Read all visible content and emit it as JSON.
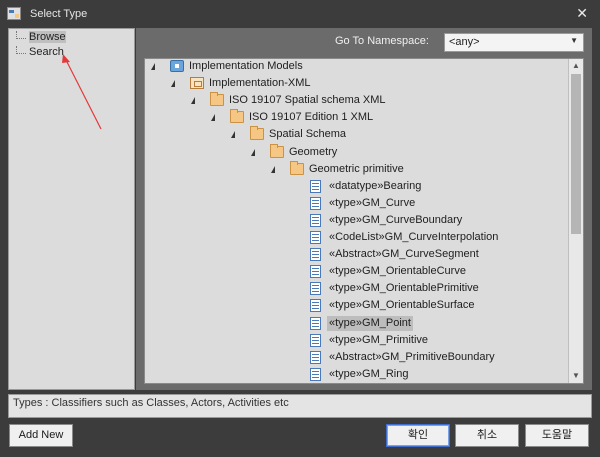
{
  "window": {
    "title": "Select Type",
    "close_glyph": "✕"
  },
  "left_panel": {
    "items": [
      {
        "label": "Browse"
      },
      {
        "label": "Search"
      }
    ]
  },
  "namespace": {
    "label": "Go To Namespace:",
    "selected": "<any>"
  },
  "tree": {
    "rows": [
      {
        "label": "Implementation Models",
        "icon": "model-icon",
        "level": 0,
        "expanded": true
      },
      {
        "label": "Implementation-XML",
        "icon": "package-icon",
        "level": 1,
        "expanded": true
      },
      {
        "label": "ISO 19107 Spatial schema XML",
        "icon": "folder-icon",
        "level": 2,
        "expanded": true
      },
      {
        "label": "ISO 19107 Edition 1 XML",
        "icon": "folder-icon",
        "level": 3,
        "expanded": true
      },
      {
        "label": "Spatial Schema",
        "icon": "folder-icon",
        "level": 4,
        "expanded": true
      },
      {
        "label": "Geometry",
        "icon": "folder-icon",
        "level": 5,
        "expanded": true
      },
      {
        "label": "Geometric primitive",
        "icon": "folder-icon",
        "level": 6,
        "expanded": true
      },
      {
        "label": "«datatype»Bearing",
        "icon": "class-icon",
        "level": 7
      },
      {
        "label": "«type»GM_Curve",
        "icon": "class-icon",
        "level": 7
      },
      {
        "label": "«type»GM_CurveBoundary",
        "icon": "class-icon",
        "level": 7
      },
      {
        "label": "«CodeList»GM_CurveInterpolation",
        "icon": "class-icon",
        "level": 7
      },
      {
        "label": "«Abstract»GM_CurveSegment",
        "icon": "class-icon",
        "level": 7
      },
      {
        "label": "«type»GM_OrientableCurve",
        "icon": "class-icon",
        "level": 7
      },
      {
        "label": "«type»GM_OrientablePrimitive",
        "icon": "class-icon",
        "level": 7
      },
      {
        "label": "«type»GM_OrientableSurface",
        "icon": "class-icon",
        "level": 7
      },
      {
        "label": "«type»GM_Point",
        "icon": "class-icon",
        "level": 7,
        "selected": true
      },
      {
        "label": "«type»GM_Primitive",
        "icon": "class-icon",
        "level": 7
      },
      {
        "label": "«Abstract»GM_PrimitiveBoundary",
        "icon": "class-icon",
        "level": 7
      },
      {
        "label": "«type»GM_Ring",
        "icon": "class-icon",
        "level": 7
      }
    ]
  },
  "status_text": "Types : Classifiers such as Classes, Actors, Activities etc",
  "buttons": {
    "add_new": "Add New",
    "ok": "확인",
    "cancel": "취소",
    "help": "도움말"
  }
}
